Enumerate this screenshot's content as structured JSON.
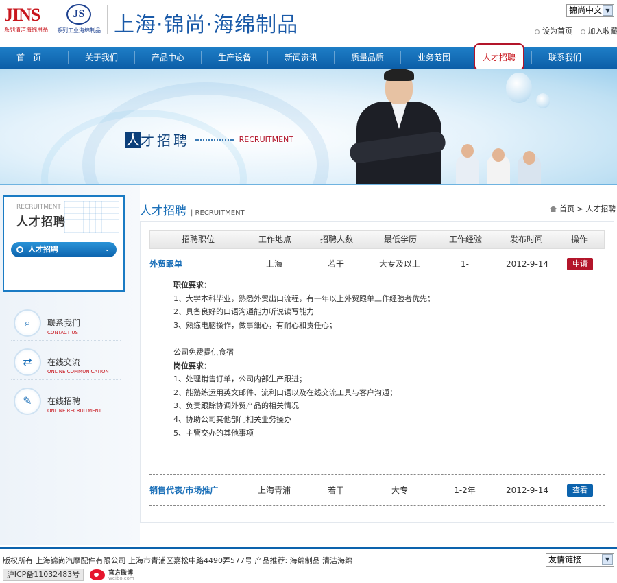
{
  "header": {
    "logo_jins": "JINS",
    "logo_jins_caption": "系列清洁海绵用品",
    "logo_js": "JS",
    "logo_js_caption": "系列工业海绵制品",
    "site_title": "上海·锦尚·海绵制品",
    "language": "锦尚中文",
    "set_home": "设为首页",
    "add_favorite": "加入收藏"
  },
  "nav": {
    "items": [
      "首　页",
      "关于我们",
      "产品中心",
      "生产设备",
      "新闻资讯",
      "质量品质",
      "业务范围",
      "人才招聘",
      "联系我们"
    ],
    "active_index": 7
  },
  "banner": {
    "title_first": "人",
    "title_rest": "才招聘",
    "title_en": "RECRUITMENT"
  },
  "sidebar": {
    "box_en": "RECRUITMENT",
    "box_cn": "人才招聘",
    "pill_label": "人才招聘",
    "links": [
      {
        "cn": "联系我们",
        "en": "CONTACT US",
        "icon": "magnifier-icon"
      },
      {
        "cn": "在线交流",
        "en": "ONLINE COMMUNICATION",
        "icon": "chat-icon"
      },
      {
        "cn": "在线招聘",
        "en": "ONLINE RECRUITMENT",
        "icon": "form-icon"
      }
    ]
  },
  "main": {
    "title_cn": "人才招聘",
    "title_en": "| RECRUITMENT",
    "breadcrumb_home": "首页",
    "breadcrumb_current": "> 人才招聘",
    "columns": [
      "招聘职位",
      "工作地点",
      "招聘人数",
      "最低学历",
      "工作经验",
      "发布时间",
      "操作"
    ],
    "jobs": [
      {
        "position": "外贸跟单",
        "location": "上海",
        "count": "若干",
        "education": "大专及以上",
        "experience": "1-",
        "date": "2012-9-14",
        "action": "申请"
      },
      {
        "position": "销售代表/市场推广",
        "location": "上海青浦",
        "count": "若干",
        "education": "大专",
        "experience": "1-2年",
        "date": "2012-9-14",
        "action": "查看"
      }
    ],
    "description": [
      {
        "text": "职位要求：",
        "bold": true
      },
      {
        "text": "1、大学本科毕业，熟悉外贸出口流程，有一年以上外贸跟单工作经验者优先；"
      },
      {
        "text": "2、具备良好的口语沟通能力听说读写能力"
      },
      {
        "text": "3、熟练电脑操作，做事细心，有耐心和责任心；"
      },
      {
        "text": ""
      },
      {
        "text": "公司免费提供食宿"
      },
      {
        "text": "岗位要求：",
        "bold": true
      },
      {
        "text": "1、处理销售订单，公司内部生产跟进；"
      },
      {
        "text": "2、能熟练运用英文邮件、流利口语以及在线交流工具与客户沟通；"
      },
      {
        "text": "3、负责跟踪协调外贸产品的相关情况"
      },
      {
        "text": "4、协助公司其他部门相关业务操办"
      },
      {
        "text": "5、主管交办的其他事项"
      }
    ]
  },
  "footer": {
    "copyright": "版权所有  上海锦尚汽摩配件有限公司  上海市青浦区嘉松中路4490弄577号  产品推荐: 海绵制品  清洁海绵",
    "icp": "沪ICP备11032483号",
    "weibo_cn": "官方微博",
    "weibo_en": "weibo.com",
    "links_select": "友情链接"
  },
  "colors": {
    "brand_blue": "#0c63ad",
    "brand_red": "#b3152a"
  }
}
